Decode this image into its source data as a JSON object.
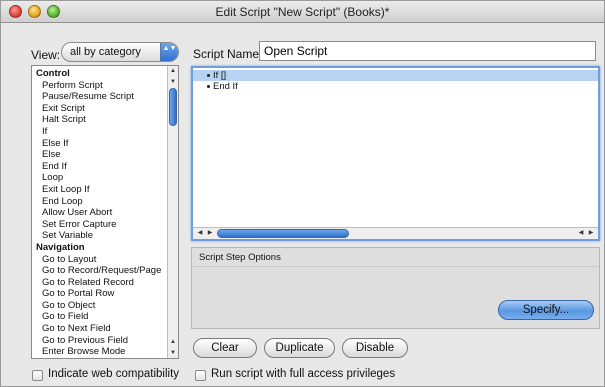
{
  "window": {
    "title": "Edit Script \"New Script\" (Books)*"
  },
  "view": {
    "label": "View:",
    "selected": "all by category"
  },
  "script_name": {
    "label": "Script Name:",
    "value": "Open Script"
  },
  "steps_list": [
    {
      "label": "Control",
      "kind": "category"
    },
    {
      "label": "Perform Script",
      "kind": "item"
    },
    {
      "label": "Pause/Resume Script",
      "kind": "item"
    },
    {
      "label": "Exit Script",
      "kind": "item"
    },
    {
      "label": "Halt Script",
      "kind": "item"
    },
    {
      "label": "If",
      "kind": "item"
    },
    {
      "label": "Else If",
      "kind": "item"
    },
    {
      "label": "Else",
      "kind": "item"
    },
    {
      "label": "End If",
      "kind": "item"
    },
    {
      "label": "Loop",
      "kind": "item"
    },
    {
      "label": "Exit Loop If",
      "kind": "item"
    },
    {
      "label": "End Loop",
      "kind": "item"
    },
    {
      "label": "Allow User Abort",
      "kind": "item"
    },
    {
      "label": "Set Error Capture",
      "kind": "item"
    },
    {
      "label": "Set Variable",
      "kind": "item"
    },
    {
      "label": "Navigation",
      "kind": "category"
    },
    {
      "label": "Go to Layout",
      "kind": "item"
    },
    {
      "label": "Go to Record/Request/Page",
      "kind": "item"
    },
    {
      "label": "Go to Related Record",
      "kind": "item"
    },
    {
      "label": "Go to Portal Row",
      "kind": "item"
    },
    {
      "label": "Go to Object",
      "kind": "item"
    },
    {
      "label": "Go to Field",
      "kind": "item"
    },
    {
      "label": "Go to Next Field",
      "kind": "item"
    },
    {
      "label": "Go to Previous Field",
      "kind": "item"
    },
    {
      "label": "Enter Browse Mode",
      "kind": "item"
    }
  ],
  "script_lines": [
    {
      "text": "If []",
      "selected": true
    },
    {
      "text": "End If",
      "selected": false
    }
  ],
  "options": {
    "label": "Script Step Options",
    "specify_label": "Specify..."
  },
  "buttons": {
    "clear": "Clear",
    "duplicate": "Duplicate",
    "disable": "Disable"
  },
  "checkboxes": {
    "web_compat": {
      "label": "Indicate web compatibility",
      "checked": false
    },
    "full_access": {
      "label": "Run script with full access privileges",
      "checked": false
    }
  },
  "icons": {
    "scroll_up": "▲",
    "scroll_down": "▼",
    "scroll_left": "◀",
    "scroll_right": "▶",
    "select_arrows": "▲▼"
  },
  "colors": {
    "accent": "#2f6fcf",
    "selection": "#b7d3f4"
  }
}
